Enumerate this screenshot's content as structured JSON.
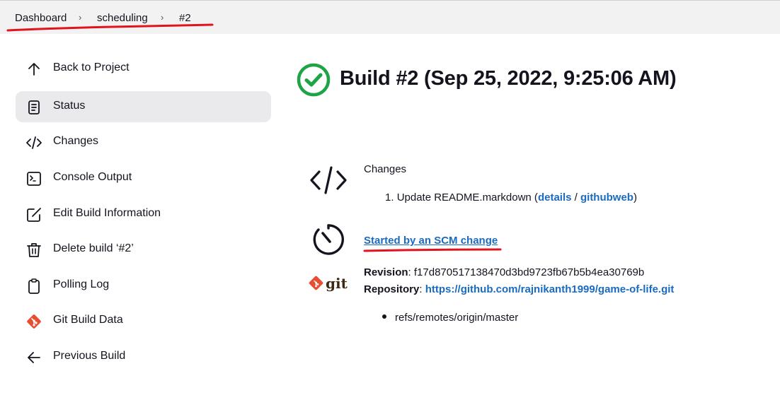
{
  "breadcrumb": {
    "items": [
      "Dashboard",
      "scheduling",
      "#2"
    ],
    "separator": "›"
  },
  "sidebar": {
    "items": [
      {
        "label": "Back to Project",
        "icon": "arrow-up-icon"
      },
      {
        "label": "Status",
        "icon": "document-icon",
        "active": true
      },
      {
        "label": "Changes",
        "icon": "code-icon"
      },
      {
        "label": "Console Output",
        "icon": "terminal-icon"
      },
      {
        "label": "Edit Build Information",
        "icon": "edit-icon"
      },
      {
        "label": "Delete build ‘#2’",
        "icon": "trash-icon"
      },
      {
        "label": "Polling Log",
        "icon": "clipboard-icon"
      },
      {
        "label": "Git Build Data",
        "icon": "git-icon"
      },
      {
        "label": "Previous Build",
        "icon": "arrow-left-icon"
      }
    ]
  },
  "build": {
    "title": "Build #2 (Sep 25, 2022, 9:25:06 AM)",
    "status_icon": "check-circle-icon",
    "status_color": "#1ea446"
  },
  "changes": {
    "heading": "Changes",
    "item_number": "1.",
    "item_text": "Update README.markdown",
    "details_link": "details",
    "githubweb_link": "githubweb"
  },
  "trigger": {
    "link_text": "Started by an SCM change"
  },
  "git": {
    "revision_label": "Revision",
    "revision_value": "f17d870517138470d3bd9723fb67b5b4ea30769b",
    "repository_label": "Repository",
    "repository_url": "https://github.com/rajnikanth1999/game-of-life.git",
    "refs": [
      "refs/remotes/origin/master"
    ],
    "logo_text": "git",
    "logo_color": "#e84e31"
  },
  "colors": {
    "link": "#1a6bbf",
    "annotation_red": "#e0141e",
    "active_bg": "#eaeaec",
    "breadcrumb_bg": "#f2f2f3"
  }
}
